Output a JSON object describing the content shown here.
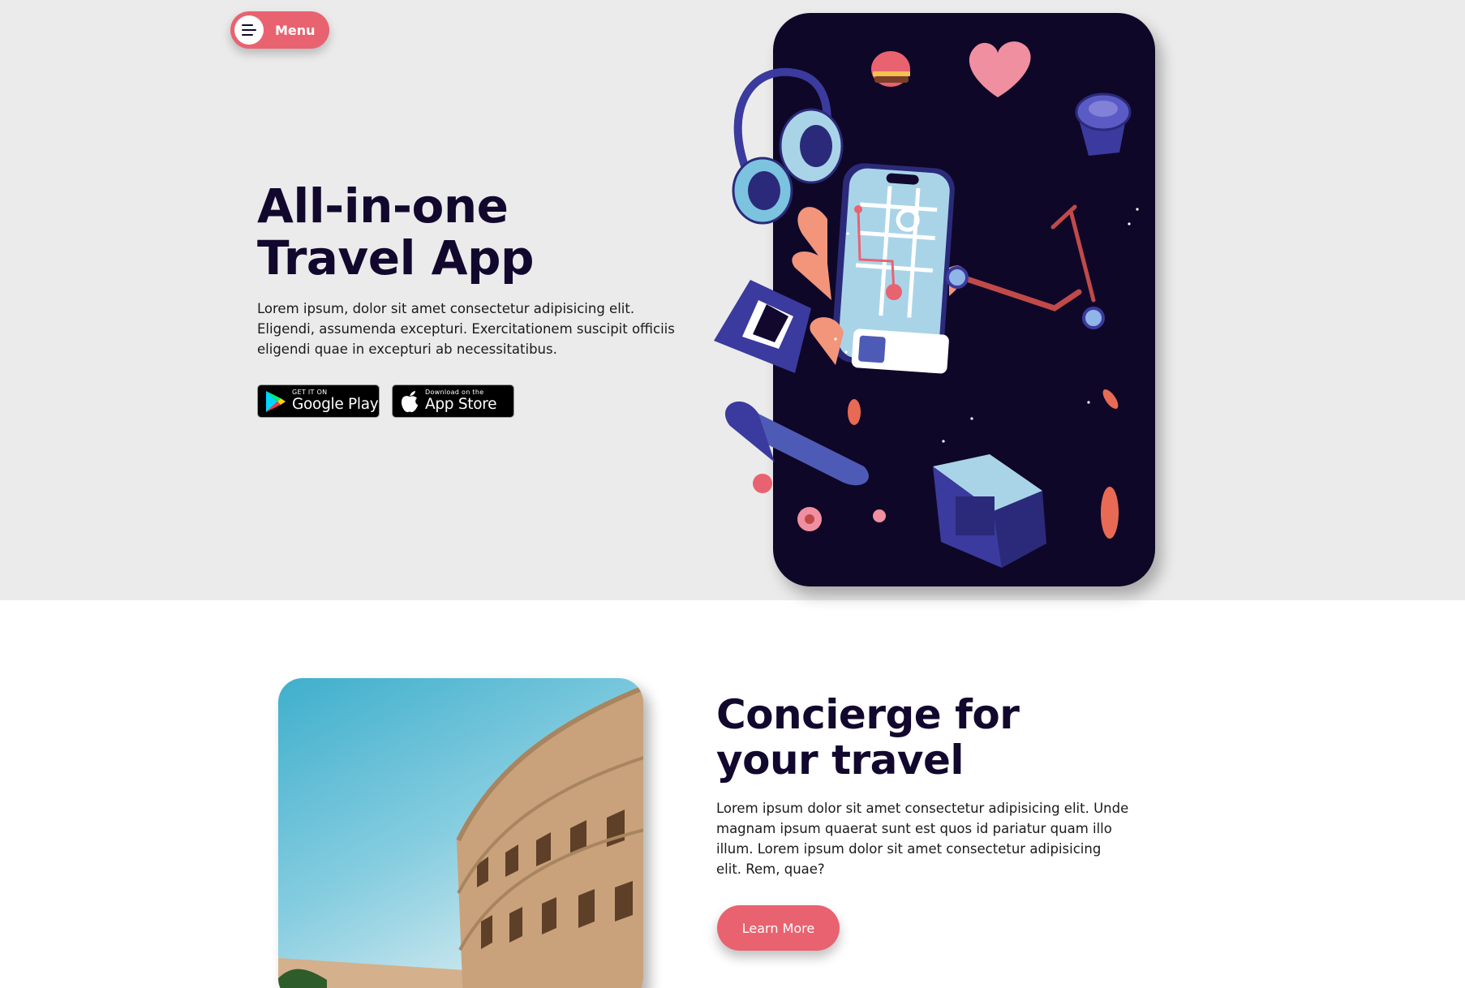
{
  "nav": {
    "menu_label": "Menu"
  },
  "hero": {
    "title_line1": "All-in-one",
    "title_line2": "Travel App",
    "description": "Lorem ipsum, dolor sit amet consectetur adipisicing elit. Eligendi, assumenda excepturi. Exercitationem suscipit officiis eligendi quae in excepturi ab necessitatibus.",
    "google_play": {
      "small": "GET IT ON",
      "big": "Google Play"
    },
    "app_store": {
      "small": "Download on the",
      "big": "App Store"
    }
  },
  "concierge": {
    "title_line1": "Concierge for",
    "title_line2": "your travel",
    "description": "Lorem ipsum dolor sit amet consectetur adipisicing elit. Unde magnam ipsum quaerat sunt est quos id pariatur quam illo illum. Lorem ipsum dolor sit amet consectetur adipisicing elit. Rem, quae?",
    "button_label": "Learn More"
  },
  "colors": {
    "accent": "#e9626f",
    "heading": "#12082e",
    "hero_bg": "#ebebeb",
    "phone_card": "#0f0727"
  },
  "icons": [
    "menu-icon",
    "google-play-icon",
    "apple-icon"
  ]
}
